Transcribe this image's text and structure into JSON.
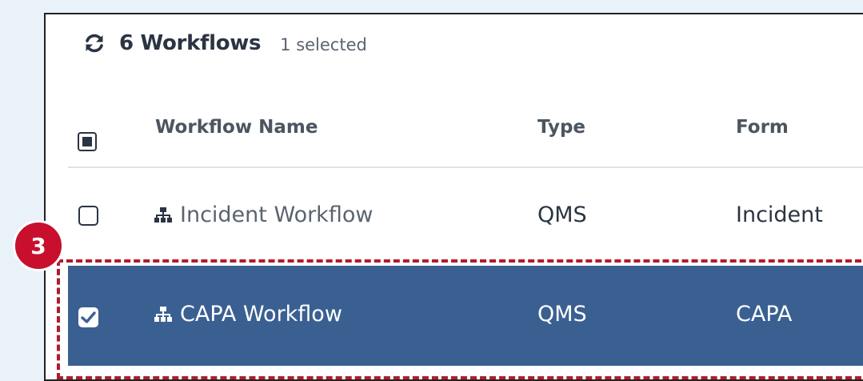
{
  "header": {
    "title": "6 Workflows",
    "selected_count": "1 selected",
    "refresh_icon": "refresh-icon"
  },
  "columns": {
    "name": "Workflow Name",
    "type": "Type",
    "form": "Form"
  },
  "rows": [
    {
      "name": "Incident Workflow",
      "type": "QMS",
      "form": "Incident",
      "selected": false,
      "icon": "workflow-hierarchy-icon"
    },
    {
      "name": "CAPA Workflow",
      "type": "QMS",
      "form": "CAPA",
      "selected": true,
      "icon": "workflow-hierarchy-icon"
    }
  ],
  "annotation": {
    "step_number": "3"
  },
  "colors": {
    "selected_row": "#3a6092",
    "highlight": "#b01c2e",
    "badge": "#c8102e",
    "page_background": "#eaf2f9"
  }
}
